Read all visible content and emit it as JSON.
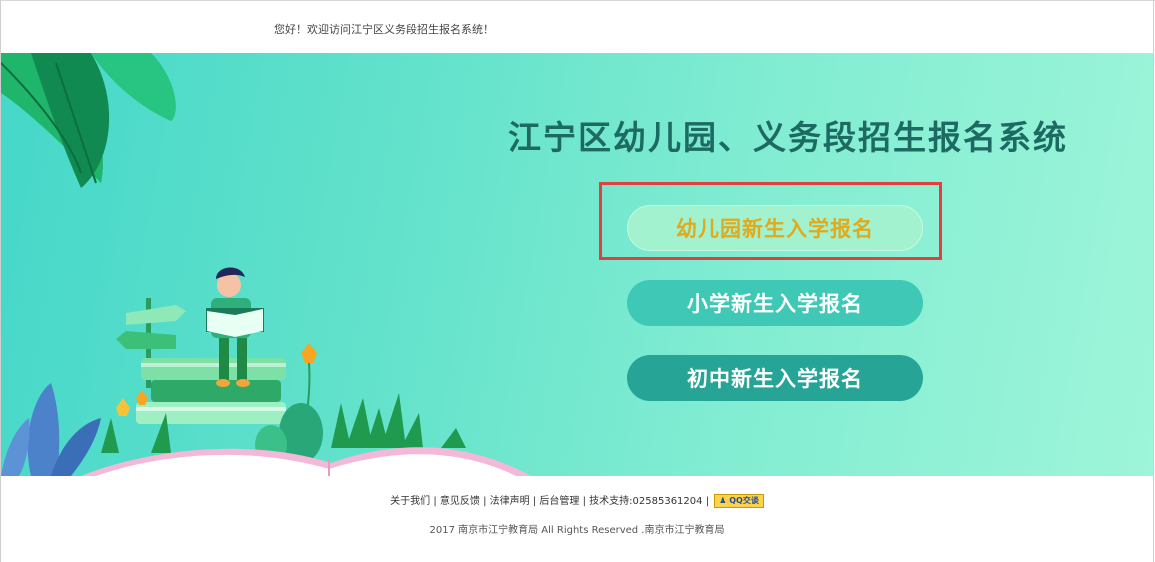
{
  "header": {
    "welcome": "您好！欢迎访问江宁区义务段招生报名系统！"
  },
  "banner": {
    "title": "江宁区幼儿园、义务段招生报名系统",
    "buttons": [
      {
        "label": "幼儿园新生入学报名"
      },
      {
        "label": "小学新生入学报名"
      },
      {
        "label": "初中新生入学报名"
      }
    ]
  },
  "footer": {
    "links": [
      "关于我们",
      "意见反馈",
      "法律声明",
      "后台管理",
      "技术支持:02585361204"
    ],
    "qq_badge": "QQ交谈",
    "copyright": "2017 南京市江宁教育局 All Rights Reserved .南京市江宁教育局"
  },
  "colors": {
    "title": "#1c6a62",
    "kindergarten_button_text": "#e1aa1c",
    "highlight_border": "#e0403f",
    "primary_button": "#3ec8b5",
    "secondary_button": "#26a597"
  },
  "icons": [
    "qq-icon"
  ]
}
